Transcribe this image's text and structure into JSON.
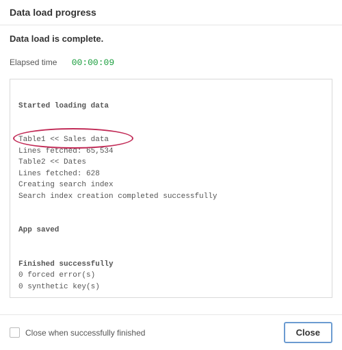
{
  "header": {
    "title": "Data load progress"
  },
  "status": {
    "text": "Data load is complete."
  },
  "elapsed": {
    "label": "Elapsed time",
    "value": "00:00:09"
  },
  "log": {
    "sections": {
      "start_heading": "Started loading data",
      "table1": "Table1 << Sales data",
      "table1_lines": "Lines fetched: 65,534",
      "table2": "Table2 << Dates",
      "table2_lines": "Lines fetched: 628",
      "searchindex": "Creating search index",
      "searchindex_done": "Search index creation completed successfully",
      "app_saved": "App saved",
      "finished_heading": "Finished successfully",
      "forced_errors": "0 forced error(s)",
      "synthetic_keys": "0 synthetic key(s)"
    }
  },
  "footer": {
    "checkbox_label": "Close when successfully finished",
    "close_button": "Close"
  }
}
